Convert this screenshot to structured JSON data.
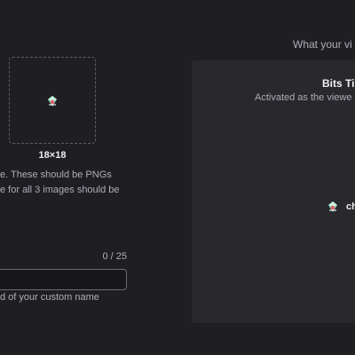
{
  "upload": {
    "size_label": "18×18",
    "help_lines": [
      "e. These should be PNGs",
      "e for all 3 images should be"
    ]
  },
  "name_field": {
    "char_count": "0 / 25",
    "value": "",
    "hint": "d of your custom name"
  },
  "preview": {
    "heading": "What your vi",
    "tier_title": "Bits Ti",
    "tier_desc": "Activated as the viewe",
    "chat_username": "ch"
  },
  "icons": {
    "badge": "bits-badge-icon"
  },
  "colors": {
    "background": "#1f1f23",
    "card": "#28282d",
    "badge_primary": "#8ed9b7",
    "badge_accent": "#e05a6a"
  }
}
